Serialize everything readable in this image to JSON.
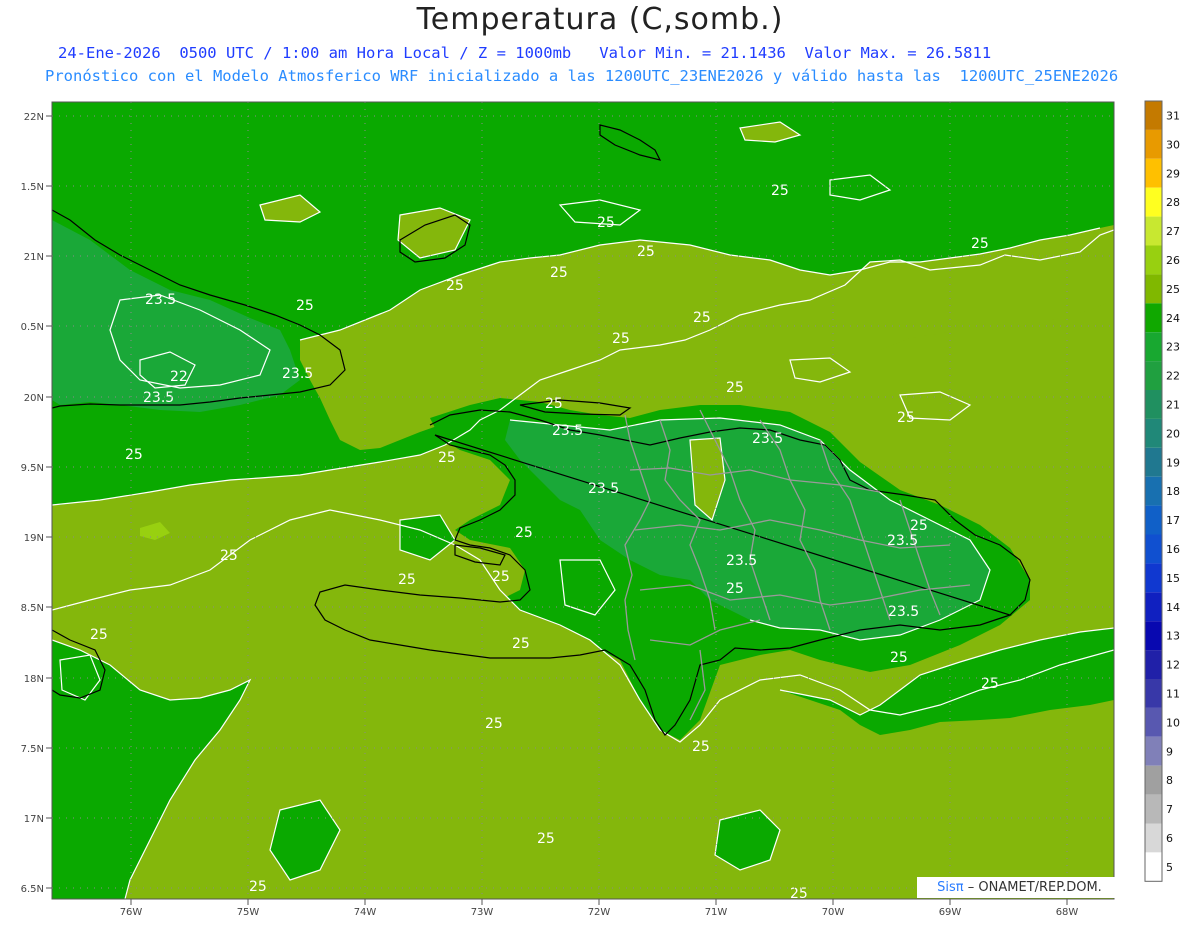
{
  "header": {
    "title": "Temperatura (C,somb.)",
    "subtitle_line1": "24-Ene-2026  0500 UTC / 1:00 am Hora Local / Z = 1000mb   Valor Min. = 21.1436  Valor Max. = 26.5811",
    "subtitle_line2": "Pronóstico con el Modelo Atmosferico WRF inicializado a las 1200UTC_23ENE2026 y válido hasta las  1200UTC_25ENE2026"
  },
  "credit": {
    "prefix": "Sisπ",
    "suffix": "– ONAMET/REP.DOM."
  },
  "map": {
    "lat_ticks": [
      "22N",
      "1.5N",
      "21N",
      "0.5N",
      "20N",
      "9.5N",
      "19N",
      "8.5N",
      "18N",
      "7.5N",
      "17N",
      "6.5N"
    ],
    "lon_ticks": [
      "76W",
      "75W",
      "74W",
      "73W",
      "72W",
      "71W",
      "70W",
      "69W",
      "68W"
    ],
    "contour_labels": [
      "25",
      "25",
      "25",
      "25",
      "25",
      "23.5",
      "25",
      "25",
      "23.5",
      "25",
      "25",
      "25",
      "22",
      "23.5",
      "23.5",
      "25",
      "25",
      "23.5",
      "25",
      "23.5",
      "25",
      "25",
      "23.5",
      "23.5",
      "25",
      "23.5",
      "25",
      "25",
      "25",
      "25",
      "25",
      "25",
      "25",
      "25",
      "25",
      "25",
      "25"
    ]
  },
  "colorbar": {
    "labels": [
      "31",
      "30",
      "29",
      "28",
      "27",
      "26",
      "25",
      "24",
      "23",
      "22",
      "21",
      "20",
      "19",
      "18",
      "17",
      "16",
      "15",
      "14",
      "13",
      "12",
      "11",
      "10",
      "9",
      "8",
      "7",
      "6",
      "5"
    ],
    "colors": [
      "#c47a00",
      "#e89a00",
      "#ffc000",
      "#ffff20",
      "#c8e830",
      "#98d010",
      "#80b800",
      "#10a800",
      "#18a830",
      "#20a040",
      "#209060",
      "#208878",
      "#207890",
      "#1870b0",
      "#1060c8",
      "#1050d0",
      "#1038d0",
      "#1020c0",
      "#0808b0",
      "#2020a8",
      "#3838a8",
      "#5858b0",
      "#8080b8",
      "#a0a0a0",
      "#b8b8b8",
      "#d8d8d8",
      "#ffffff"
    ]
  },
  "colors": {
    "land_warm": "#84b70c",
    "sea_cool": "#0aa900",
    "ridge_dark": "#1aa838",
    "contour": "#ffffff",
    "coast": "#000000",
    "borders": "#9a9a9a"
  }
}
